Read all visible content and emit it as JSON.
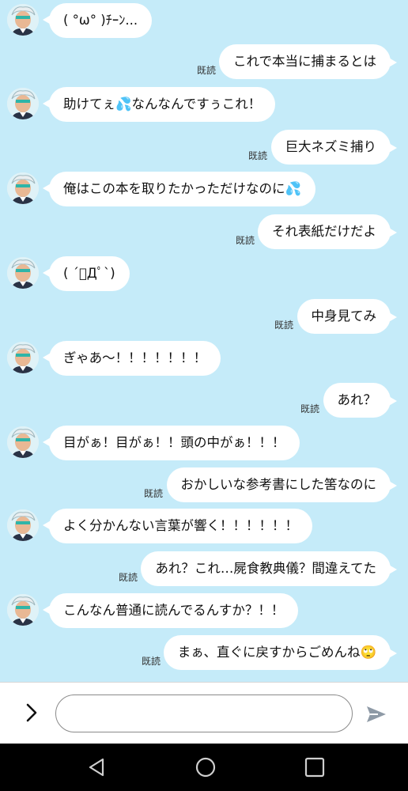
{
  "messages": [
    {
      "side": "in",
      "text": "( °ω° )ﾁｰﾝ..."
    },
    {
      "side": "out",
      "text": "これで本当に捕まるとは",
      "read": "既読"
    },
    {
      "side": "in",
      "text": "助けてぇ💦なんなんですぅこれ！"
    },
    {
      "side": "out",
      "text": "巨大ネズミ捕り",
      "read": "既読"
    },
    {
      "side": "in",
      "text": "俺はこの本を取りたかっただけなのに💦"
    },
    {
      "side": "out",
      "text": "それ表紙だけだよ",
      "read": "既読"
    },
    {
      "side": "in",
      "text": "( ´ﾟДﾟ`)"
    },
    {
      "side": "out",
      "text": "中身見てみ",
      "read": "既読"
    },
    {
      "side": "in",
      "text": "ぎゃあ〜！！！！！！！"
    },
    {
      "side": "out",
      "text": "あれ？",
      "read": "既読"
    },
    {
      "side": "in",
      "text": "目がぁ！目がぁ！！頭の中がぁ！！！"
    },
    {
      "side": "out",
      "text": "おかしいな参考書にした筈なのに",
      "read": "既読"
    },
    {
      "side": "in",
      "text": "よく分かんない言葉が響く！！！！！！"
    },
    {
      "side": "out",
      "text": "あれ？これ…屍食教典儀？間違えてた",
      "read": "既読"
    },
    {
      "side": "in",
      "text": "こんなん普通に読んでるんすか？！！"
    },
    {
      "side": "out",
      "text": "まぁ、直ぐに戻すからごめんね🙄",
      "read": "既読"
    }
  ],
  "input": {
    "value": "",
    "placeholder": ""
  },
  "icons": {
    "expand": "chevron-right-icon",
    "send": "send-icon",
    "back": "nav-back-icon",
    "home": "nav-home-icon",
    "recents": "nav-recents-icon"
  },
  "colors": {
    "background": "#c5ebf9",
    "bubble": "#ffffff",
    "navbar": "#000000"
  }
}
